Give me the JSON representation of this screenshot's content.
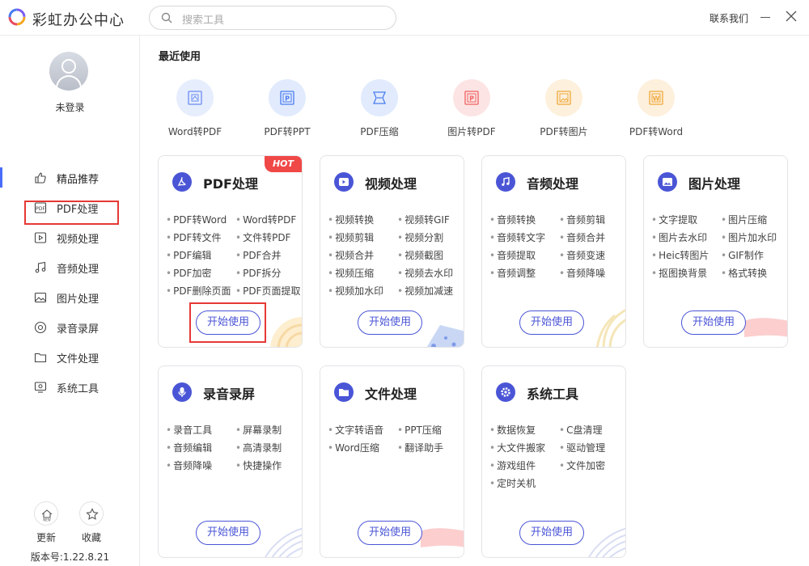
{
  "app": {
    "title": "彩虹办公中心"
  },
  "search": {
    "placeholder": "搜索工具"
  },
  "header": {
    "contact": "联系我们"
  },
  "user": {
    "status": "未登录"
  },
  "sidebar": {
    "items": [
      {
        "label": "精品推荐",
        "icon": "thumbs-up-icon"
      },
      {
        "label": "PDF处理",
        "icon": "pdf-icon"
      },
      {
        "label": "视频处理",
        "icon": "play-icon"
      },
      {
        "label": "音频处理",
        "icon": "music-note-icon"
      },
      {
        "label": "图片处理",
        "icon": "image-icon"
      },
      {
        "label": "录音录屏",
        "icon": "record-icon"
      },
      {
        "label": "文件处理",
        "icon": "folder-icon"
      },
      {
        "label": "系统工具",
        "icon": "monitor-icon"
      }
    ],
    "update": "更新",
    "favorite": "收藏",
    "version": "版本号:1.22.8.21"
  },
  "recent": {
    "title": "最近使用",
    "items": [
      {
        "label": "Word转PDF",
        "icon_text": "",
        "color": "#6b8df2"
      },
      {
        "label": "PDF转PPT",
        "icon_text": "P",
        "color": "#4a7cf0"
      },
      {
        "label": "PDF压缩",
        "icon_text": "",
        "color": "#4a7cf0"
      },
      {
        "label": "图片转PDF",
        "icon_text": "P",
        "color": "#f06262"
      },
      {
        "label": "PDF转图片",
        "icon_text": "",
        "color": "#f0a83a"
      },
      {
        "label": "PDF转Word",
        "icon_text": "W",
        "color": "#f0a83a"
      }
    ]
  },
  "cards": [
    {
      "title": "PDF处理",
      "hot": "HOT",
      "features": [
        "PDF转Word",
        "Word转PDF",
        "PDF转文件",
        "文件转PDF",
        "PDF编辑",
        "PDF合并",
        "PDF加密",
        "PDF拆分",
        "PDF删除页面",
        "PDF页面提取"
      ],
      "button": "开始使用"
    },
    {
      "title": "视频处理",
      "features": [
        "视频转换",
        "视频转GIF",
        "视频剪辑",
        "视频分割",
        "视频合并",
        "视频截图",
        "视频压缩",
        "视频去水印",
        "视频加水印",
        "视频加减速"
      ],
      "button": "开始使用"
    },
    {
      "title": "音频处理",
      "features": [
        "音频转换",
        "音频剪辑",
        "音频转文字",
        "音频合并",
        "音频提取",
        "音频变速",
        "音频调整",
        "音频降噪"
      ],
      "button": "开始使用"
    },
    {
      "title": "图片处理",
      "features": [
        "文字提取",
        "图片压缩",
        "图片去水印",
        "图片加水印",
        "Heic转图片",
        "GIF制作",
        "抠图换背景",
        "格式转换"
      ],
      "button": "开始使用"
    },
    {
      "title": "录音录屏",
      "features": [
        "录音工具",
        "屏幕录制",
        "音频编辑",
        "高清录制",
        "音频降噪",
        "快捷操作"
      ],
      "button": "开始使用"
    },
    {
      "title": "文件处理",
      "features": [
        "文字转语音",
        "PPT压缩",
        "Word压缩",
        "翻译助手"
      ],
      "button": "开始使用"
    },
    {
      "title": "系统工具",
      "features": [
        "数据恢复",
        "C盘清理",
        "大文件搬家",
        "驱动管理",
        "游戏组件",
        "文件加密",
        "定时关机"
      ],
      "button": "开始使用"
    }
  ],
  "colors": {
    "accent": "#4a55d6",
    "hot": "#f04747",
    "highlight": "#e53935"
  }
}
